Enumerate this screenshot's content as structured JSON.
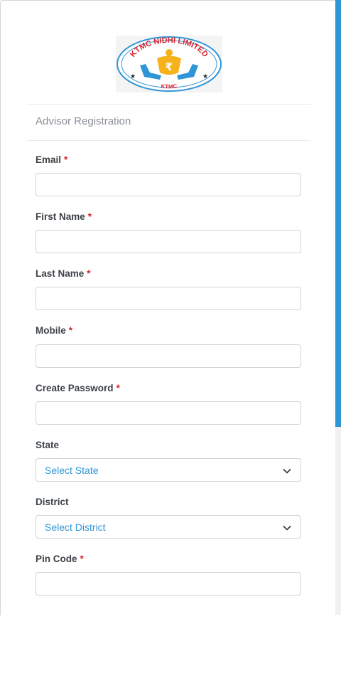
{
  "logo": {
    "text": "KTMC NIDHI LIMITED",
    "subtext": "KTMC",
    "symbol": "₹",
    "colors": {
      "ring": "#2f96d6",
      "text": "#d9232d",
      "bag": "#f5b21b",
      "hands": "#2f96d6"
    }
  },
  "form": {
    "heading": "Advisor Registration",
    "required_marker": "*",
    "fields": {
      "email": {
        "label": "Email",
        "value": ""
      },
      "first_name": {
        "label": "First Name",
        "value": ""
      },
      "last_name": {
        "label": "Last Name",
        "value": ""
      },
      "mobile": {
        "label": "Mobile",
        "value": ""
      },
      "password": {
        "label": "Create Password",
        "value": ""
      },
      "state": {
        "label": "State",
        "selected": "Select State"
      },
      "district": {
        "label": "District",
        "selected": "Select District"
      },
      "pin_code": {
        "label": "Pin Code",
        "value": ""
      }
    }
  },
  "colors": {
    "accent": "#2f96d6",
    "required": "#d9232d",
    "label": "#3d4247",
    "muted": "#8a8f96"
  }
}
